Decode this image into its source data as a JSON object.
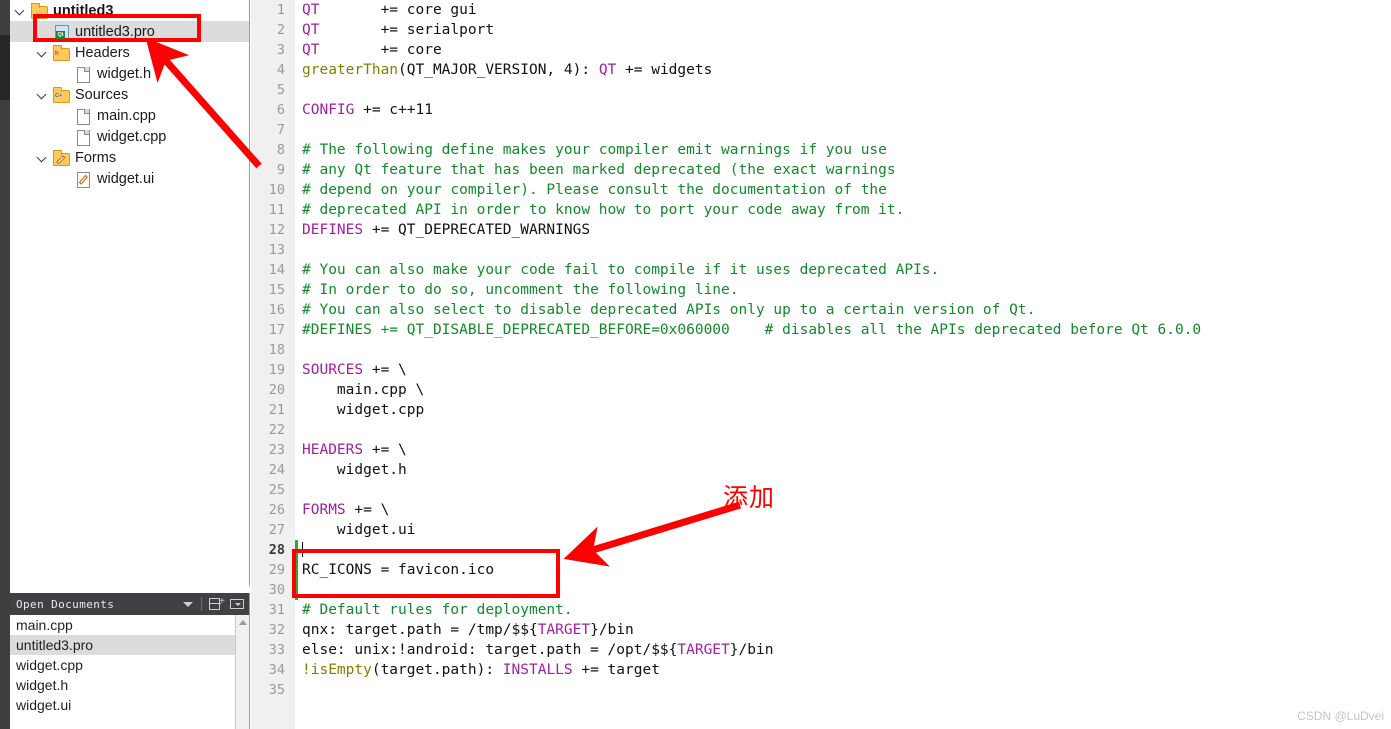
{
  "project_tree": {
    "items": [
      {
        "label": "untitled3",
        "icon": "folder-project-icon",
        "indent": 0,
        "expanded": true,
        "bold": true,
        "selected": false
      },
      {
        "label": "untitled3.pro",
        "icon": "qt-pro-file-icon",
        "indent": 1,
        "expanded": null,
        "bold": false,
        "selected": true
      },
      {
        "label": "Headers",
        "icon": "headers-folder-icon",
        "indent": 1,
        "expanded": true,
        "bold": false,
        "selected": false
      },
      {
        "label": "widget.h",
        "icon": "file-icon",
        "indent": 2,
        "expanded": null,
        "bold": false,
        "selected": false
      },
      {
        "label": "Sources",
        "icon": "sources-folder-icon",
        "indent": 1,
        "expanded": true,
        "bold": false,
        "selected": false
      },
      {
        "label": "main.cpp",
        "icon": "file-icon",
        "indent": 2,
        "expanded": null,
        "bold": false,
        "selected": false
      },
      {
        "label": "widget.cpp",
        "icon": "file-icon",
        "indent": 2,
        "expanded": null,
        "bold": false,
        "selected": false
      },
      {
        "label": "Forms",
        "icon": "forms-folder-icon",
        "indent": 1,
        "expanded": true,
        "bold": false,
        "selected": false
      },
      {
        "label": "widget.ui",
        "icon": "ui-file-icon",
        "indent": 2,
        "expanded": null,
        "bold": false,
        "selected": false
      }
    ]
  },
  "open_documents": {
    "title": "Open Documents",
    "icons": [
      "chevron-down-icon",
      "split-window-icon",
      "close-panel-icon"
    ],
    "items": [
      {
        "label": "main.cpp",
        "selected": false
      },
      {
        "label": "untitled3.pro",
        "selected": true
      },
      {
        "label": "widget.cpp",
        "selected": false
      },
      {
        "label": "widget.h",
        "selected": false
      },
      {
        "label": "widget.ui",
        "selected": false
      }
    ]
  },
  "editor": {
    "cursor_line": 28,
    "change_marker_lines": [
      28,
      29,
      30
    ],
    "lines": [
      {
        "n": 1,
        "tokens": [
          {
            "t": "QT",
            "c": "kw"
          },
          {
            "t": "       += core gui",
            "c": "pl"
          }
        ]
      },
      {
        "n": 2,
        "tokens": [
          {
            "t": "QT",
            "c": "kw"
          },
          {
            "t": "       += serialport",
            "c": "pl"
          }
        ]
      },
      {
        "n": 3,
        "tokens": [
          {
            "t": "QT",
            "c": "kw"
          },
          {
            "t": "       += core",
            "c": "pl"
          }
        ]
      },
      {
        "n": 4,
        "tokens": [
          {
            "t": "greaterThan",
            "c": "fn"
          },
          {
            "t": "(QT_MAJOR_VERSION, 4): ",
            "c": "pl"
          },
          {
            "t": "QT",
            "c": "kw"
          },
          {
            "t": " += widgets",
            "c": "pl"
          }
        ]
      },
      {
        "n": 5,
        "tokens": []
      },
      {
        "n": 6,
        "tokens": [
          {
            "t": "CONFIG",
            "c": "kw"
          },
          {
            "t": " += c++11",
            "c": "pl"
          }
        ]
      },
      {
        "n": 7,
        "tokens": []
      },
      {
        "n": 8,
        "tokens": [
          {
            "t": "# The following define makes your compiler emit warnings if you use",
            "c": "cm"
          }
        ]
      },
      {
        "n": 9,
        "tokens": [
          {
            "t": "# any Qt feature that has been marked deprecated (the exact warnings",
            "c": "cm"
          }
        ]
      },
      {
        "n": 10,
        "tokens": [
          {
            "t": "# depend on your compiler). Please consult the documentation of the",
            "c": "cm"
          }
        ]
      },
      {
        "n": 11,
        "tokens": [
          {
            "t": "# deprecated API in order to know how to port your code away from it.",
            "c": "cm"
          }
        ]
      },
      {
        "n": 12,
        "tokens": [
          {
            "t": "DEFINES",
            "c": "kw"
          },
          {
            "t": " += QT_DEPRECATED_WARNINGS",
            "c": "pl"
          }
        ]
      },
      {
        "n": 13,
        "tokens": []
      },
      {
        "n": 14,
        "tokens": [
          {
            "t": "# You can also make your code fail to compile if it uses deprecated APIs.",
            "c": "cm"
          }
        ]
      },
      {
        "n": 15,
        "tokens": [
          {
            "t": "# In order to do so, uncomment the following line.",
            "c": "cm"
          }
        ]
      },
      {
        "n": 16,
        "tokens": [
          {
            "t": "# You can also select to disable deprecated APIs only up to a certain version of Qt.",
            "c": "cm"
          }
        ]
      },
      {
        "n": 17,
        "tokens": [
          {
            "t": "#DEFINES += QT_DISABLE_DEPRECATED_BEFORE=0x060000    # disables all the APIs deprecated before Qt 6.0.0",
            "c": "cm"
          }
        ]
      },
      {
        "n": 18,
        "tokens": []
      },
      {
        "n": 19,
        "tokens": [
          {
            "t": "SOURCES",
            "c": "kw"
          },
          {
            "t": " += \\",
            "c": "pl"
          }
        ]
      },
      {
        "n": 20,
        "tokens": [
          {
            "t": "    main.cpp \\",
            "c": "pl"
          }
        ]
      },
      {
        "n": 21,
        "tokens": [
          {
            "t": "    widget.cpp",
            "c": "pl"
          }
        ]
      },
      {
        "n": 22,
        "tokens": []
      },
      {
        "n": 23,
        "tokens": [
          {
            "t": "HEADERS",
            "c": "kw"
          },
          {
            "t": " += \\",
            "c": "pl"
          }
        ]
      },
      {
        "n": 24,
        "tokens": [
          {
            "t": "    widget.h",
            "c": "pl"
          }
        ]
      },
      {
        "n": 25,
        "tokens": []
      },
      {
        "n": 26,
        "tokens": [
          {
            "t": "FORMS",
            "c": "kw"
          },
          {
            "t": " += \\",
            "c": "pl"
          }
        ]
      },
      {
        "n": 27,
        "tokens": [
          {
            "t": "    widget.ui",
            "c": "pl"
          }
        ]
      },
      {
        "n": 28,
        "tokens": []
      },
      {
        "n": 29,
        "tokens": [
          {
            "t": "RC_ICONS = favicon.ico",
            "c": "pl"
          }
        ]
      },
      {
        "n": 30,
        "tokens": []
      },
      {
        "n": 31,
        "tokens": [
          {
            "t": "# Default rules for deployment.",
            "c": "cm"
          }
        ]
      },
      {
        "n": 32,
        "tokens": [
          {
            "t": "qnx: target.path = /tmp/$${",
            "c": "pl"
          },
          {
            "t": "TARGET",
            "c": "var"
          },
          {
            "t": "}/bin",
            "c": "pl"
          }
        ]
      },
      {
        "n": 33,
        "tokens": [
          {
            "t": "else: unix:!android: target.path = /opt/$${",
            "c": "pl"
          },
          {
            "t": "TARGET",
            "c": "var"
          },
          {
            "t": "}/bin",
            "c": "pl"
          }
        ]
      },
      {
        "n": 34,
        "tokens": [
          {
            "t": "!isEmpty",
            "c": "fn"
          },
          {
            "t": "(target.path): ",
            "c": "pl"
          },
          {
            "t": "INSTALLS",
            "c": "kw"
          },
          {
            "t": " += target",
            "c": "pl"
          }
        ]
      },
      {
        "n": 35,
        "tokens": []
      }
    ]
  },
  "annotations": {
    "callout_text": "添加",
    "callout_color": "#ff0000",
    "highlight_boxes": [
      {
        "name": "tree-pro-file-highlight",
        "target": "untitled3.pro"
      },
      {
        "name": "code-rc-icons-highlight",
        "target": "RC_ICONS = favicon.ico"
      }
    ]
  },
  "watermark": {
    "text": "CSDN @LuDvei"
  }
}
